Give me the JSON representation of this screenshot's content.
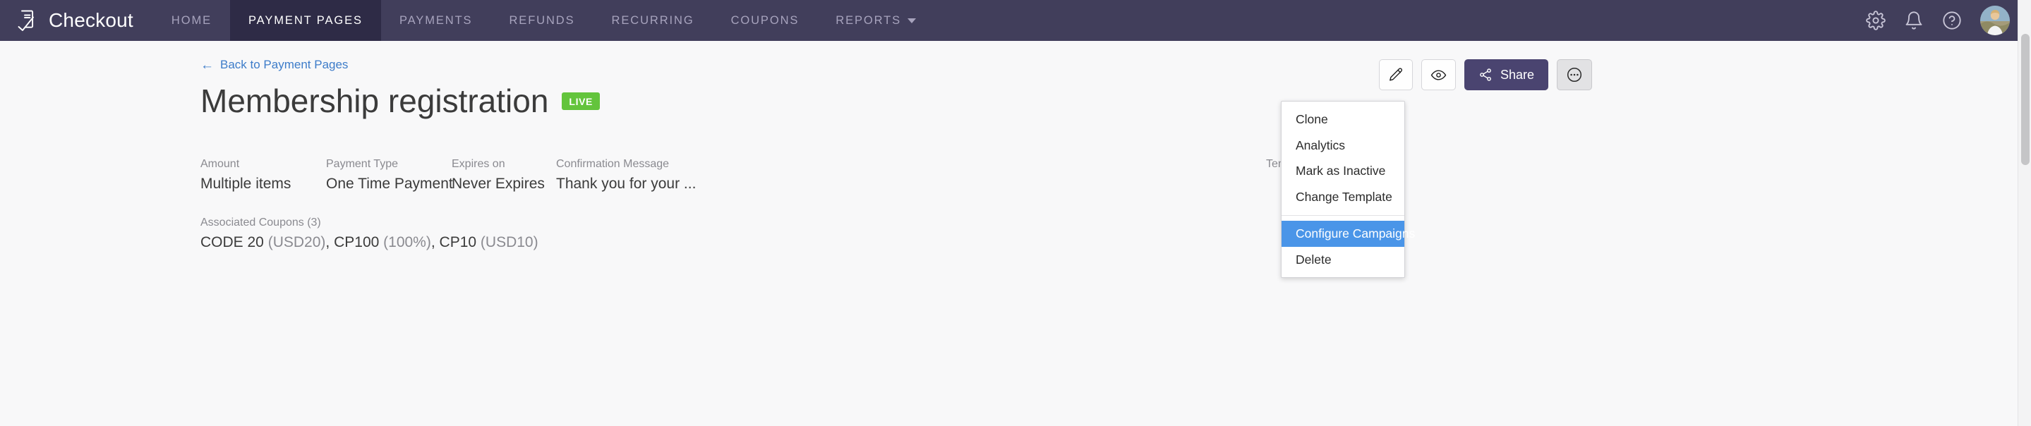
{
  "navbar": {
    "brand": "Checkout",
    "logo_icon": "receipt-check-icon",
    "items": [
      {
        "label": "HOME",
        "active": false,
        "has_caret": false
      },
      {
        "label": "PAYMENT PAGES",
        "active": true,
        "has_caret": false
      },
      {
        "label": "PAYMENTS",
        "active": false,
        "has_caret": false
      },
      {
        "label": "REFUNDS",
        "active": false,
        "has_caret": false
      },
      {
        "label": "RECURRING",
        "active": false,
        "has_caret": false
      },
      {
        "label": "COUPONS",
        "active": false,
        "has_caret": false
      },
      {
        "label": "REPORTS",
        "active": false,
        "has_caret": true
      }
    ],
    "right_icons": [
      {
        "name": "gear-icon"
      },
      {
        "name": "bell-icon"
      },
      {
        "name": "help-circle-icon"
      }
    ],
    "avatar_alt": "user-avatar",
    "bg_color": "#413e5b",
    "active_bg_color": "#2e2b46"
  },
  "page": {
    "back_link": "Back to Payment Pages",
    "back_arrow": "←",
    "title": "Membership registration",
    "status_badge": "LIVE",
    "status_color": "#63c43c"
  },
  "actions": {
    "edit_icon": "pencil-icon",
    "preview_icon": "eye-icon",
    "share_label": "Share",
    "share_icon": "share-nodes-icon",
    "share_color": "#4a4470",
    "more_icon": "ellipsis-circle-icon"
  },
  "dropdown": {
    "highlight_color": "#4a95e8",
    "items": [
      {
        "label": "Clone",
        "highlighted": false
      },
      {
        "label": "Analytics",
        "highlighted": false
      },
      {
        "label": "Mark as Inactive",
        "highlighted": false
      },
      {
        "label": "Change Template",
        "highlighted": false
      },
      {
        "label": "Configure Campaigns",
        "highlighted": true
      },
      {
        "label": "Delete",
        "highlighted": false
      }
    ],
    "divider_after_index": 3
  },
  "details": {
    "amount": {
      "label": "Amount",
      "value": "Multiple items"
    },
    "payment_type": {
      "label": "Payment Type",
      "value": "One Time Payment"
    },
    "expires_on": {
      "label": "Expires on",
      "value": "Never Expires"
    },
    "confirmation_message": {
      "label": "Confirmation Message",
      "value": "Thank you for your ..."
    },
    "template": {
      "label": "Template",
      "value": ""
    }
  },
  "coupons": {
    "label": "Associated Coupons (3)",
    "items": [
      {
        "code": "CODE 20",
        "discount": "(USD20)"
      },
      {
        "code": "CP100",
        "discount": "(100%)"
      },
      {
        "code": "CP10",
        "discount": "(USD10)"
      }
    ]
  }
}
